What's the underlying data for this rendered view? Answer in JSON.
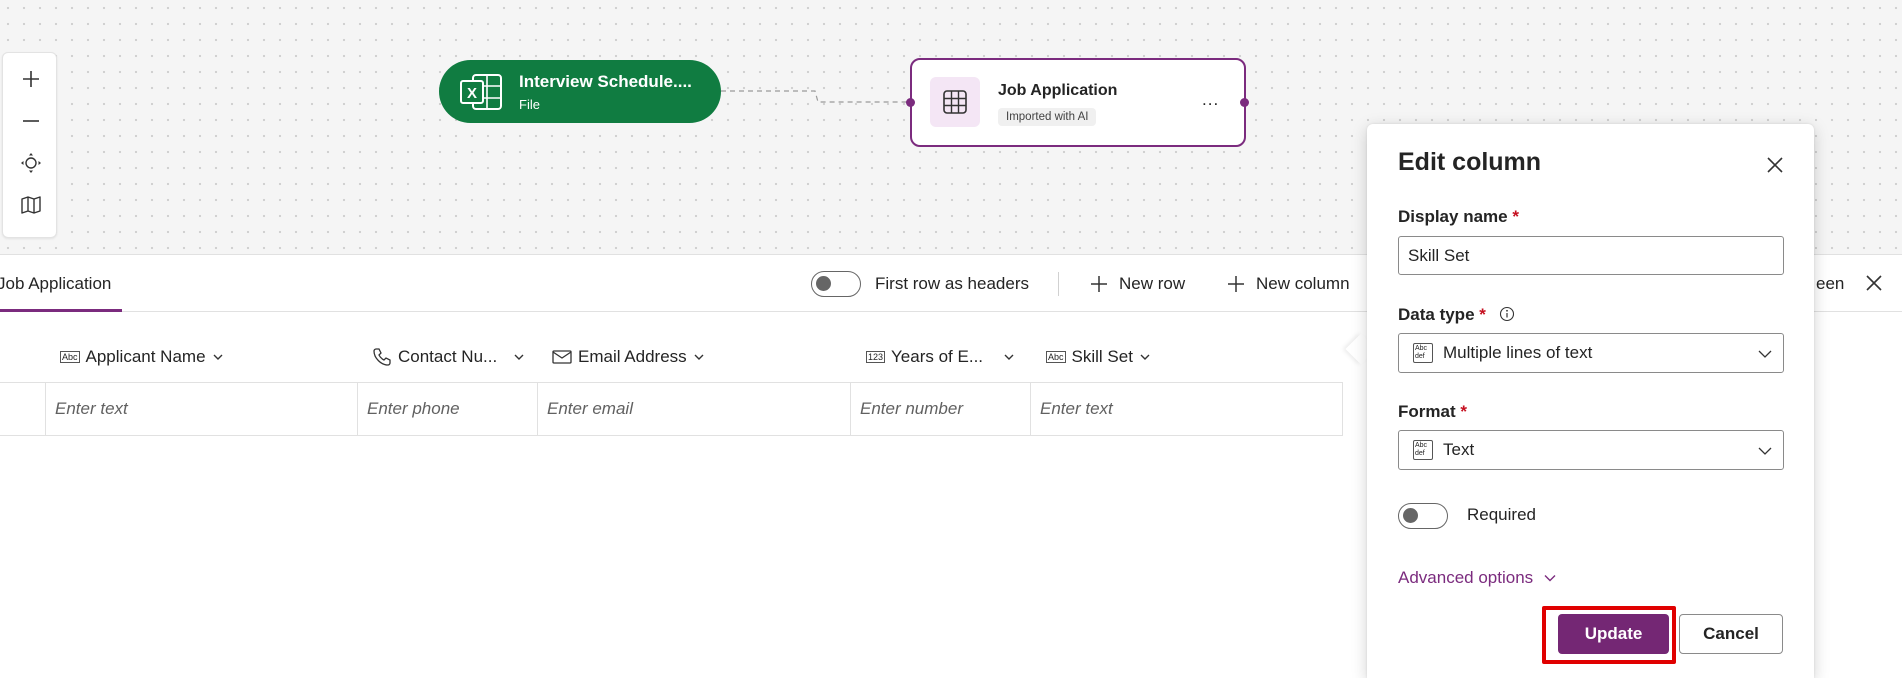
{
  "canvas": {
    "zoom_tools": [
      "zoom-in",
      "zoom-out",
      "fit-view",
      "minimap"
    ],
    "file_node": {
      "title": "Interview Schedule....",
      "subtitle": "File"
    },
    "table_node": {
      "title": "Job Application",
      "badge": "Imported with AI",
      "more": "..."
    }
  },
  "panel": {
    "tab": "Job Application",
    "first_row_headers_label": "First row as headers",
    "new_row_label": "New row",
    "new_column_label": "New column",
    "clipped_label": "een",
    "columns": [
      {
        "label": "Applicant Name",
        "type_icon": "text-type-icon",
        "placeholder": "Enter text"
      },
      {
        "label": "Contact Nu...",
        "type_icon": "phone-icon",
        "placeholder": "Enter phone"
      },
      {
        "label": "Email Address",
        "type_icon": "mail-icon",
        "placeholder": "Enter email"
      },
      {
        "label": "Years of E...",
        "type_icon": "number-type-icon",
        "placeholder": "Enter number"
      },
      {
        "label": "Skill Set",
        "type_icon": "text-type-icon",
        "placeholder": "Enter text"
      }
    ]
  },
  "edit_column": {
    "title": "Edit column",
    "display_name_label": "Display name",
    "display_name_value": "Skill Set",
    "required_mark": "*",
    "data_type_label": "Data type",
    "data_type_value": "Multiple lines of text",
    "format_label": "Format",
    "format_value": "Text",
    "required_label": "Required",
    "advanced_label": "Advanced options",
    "update_label": "Update",
    "cancel_label": "Cancel"
  },
  "colors": {
    "accent": "#742774",
    "excel_green": "#107c41",
    "highlight": "#e00000"
  }
}
